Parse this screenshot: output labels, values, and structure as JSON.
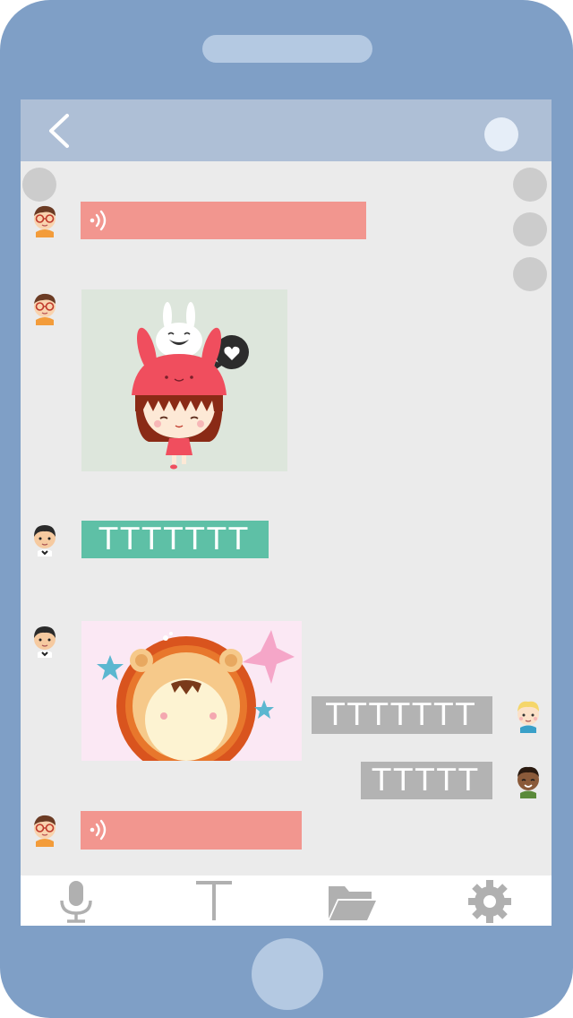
{
  "header": {
    "back_icon": "chevron-left-icon",
    "menu_icon": "circle-icon"
  },
  "messages": [
    {
      "side": "left",
      "type": "voice",
      "avatar": "boy-glasses-avatar"
    },
    {
      "side": "left",
      "type": "image",
      "avatar": "boy-glasses-avatar",
      "content": "girl-bunny-hat-sticker"
    },
    {
      "side": "left",
      "type": "text",
      "avatar": "boy-black-hair-avatar",
      "text": "TTTTTTT"
    },
    {
      "side": "left",
      "type": "image",
      "avatar": "boy-black-hair-avatar",
      "content": "lion-costume-sticker"
    },
    {
      "side": "right",
      "type": "text",
      "avatar": "blond-kid-avatar",
      "text": "TTTTTTT"
    },
    {
      "side": "right",
      "type": "text",
      "avatar": "dark-skin-boy-avatar",
      "text": "TTTTT"
    },
    {
      "side": "left",
      "type": "voice",
      "avatar": "boy-glasses-avatar"
    }
  ],
  "toolbar": {
    "items": [
      {
        "icon": "microphone-icon"
      },
      {
        "icon": "text-icon"
      },
      {
        "icon": "folder-icon"
      },
      {
        "icon": "gear-icon"
      }
    ]
  },
  "colors": {
    "phone_body": "#7f9fc6",
    "header_bg": "#aebfd6",
    "chat_bg": "#ebebeb",
    "voice_bubble": "#f2968f",
    "text_bubble_green": "#5ec0a6",
    "text_bubble_grey": "#b3b3b3",
    "toolbar_icon": "#b0b0b0"
  }
}
